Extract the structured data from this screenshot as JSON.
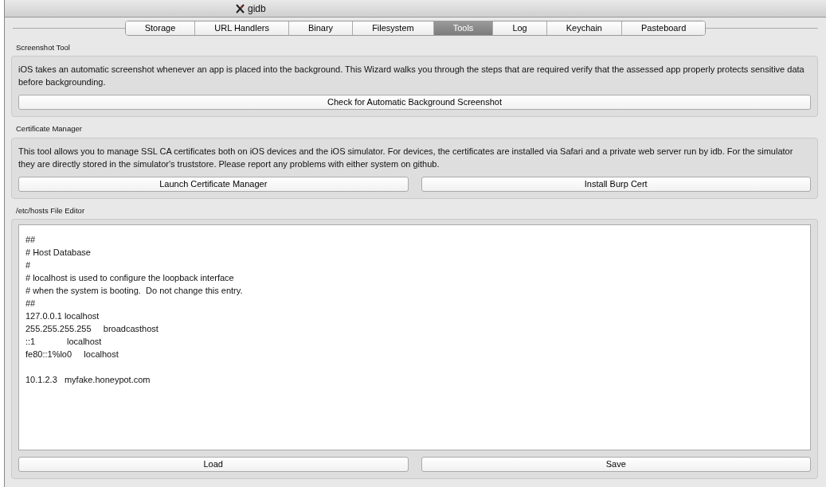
{
  "window": {
    "title": "gidb"
  },
  "tabs": [
    {
      "label": "Storage",
      "selected": false
    },
    {
      "label": "URL Handlers",
      "selected": false
    },
    {
      "label": "Binary",
      "selected": false
    },
    {
      "label": "Filesystem",
      "selected": false
    },
    {
      "label": "Tools",
      "selected": true
    },
    {
      "label": "Log",
      "selected": false
    },
    {
      "label": "Keychain",
      "selected": false
    },
    {
      "label": "Pasteboard",
      "selected": false
    }
  ],
  "sections": [
    {
      "title": "Screenshot Tool",
      "kind": "info",
      "description": "iOS takes an automatic screenshot whenever an app is placed into the background. This Wizard walks you through the steps that are required verify that the assessed app properly protects sensitive data before backgrounding.",
      "buttons": [
        "Check for Automatic Background Screenshot"
      ]
    },
    {
      "title": "Certificate Manager",
      "kind": "info",
      "description": "This tool allows you to manage SSL CA certificates both on iOS devices and the iOS simulator. For devices, the certificates are installed via Safari and a private web server run by idb. For the simulator they are directly stored in the simulator's truststore. Please report any problems with either system on github.",
      "buttons": [
        "Launch Certificate Manager",
        "Install Burp Cert"
      ]
    },
    {
      "title": "/etc/hosts File Editor",
      "kind": "editor",
      "paragraphs": [
        {
          "lines": [
            "##",
            "# Host Database",
            "#",
            "# localhost is used to configure the loopback interface",
            "# when the system is booting.  Do not change this entry.",
            "##",
            "127.0.0.1\tlocalhost",
            "255.255.255.255\tbroadcasthost",
            "::1             localhost",
            "fe80::1%lo0\tlocalhost"
          ]
        },
        {
          "lines": [
            "10.1.2.3\tmyfake.honeypot.com"
          ]
        }
      ],
      "buttons": [
        "Load",
        "Save"
      ]
    }
  ]
}
